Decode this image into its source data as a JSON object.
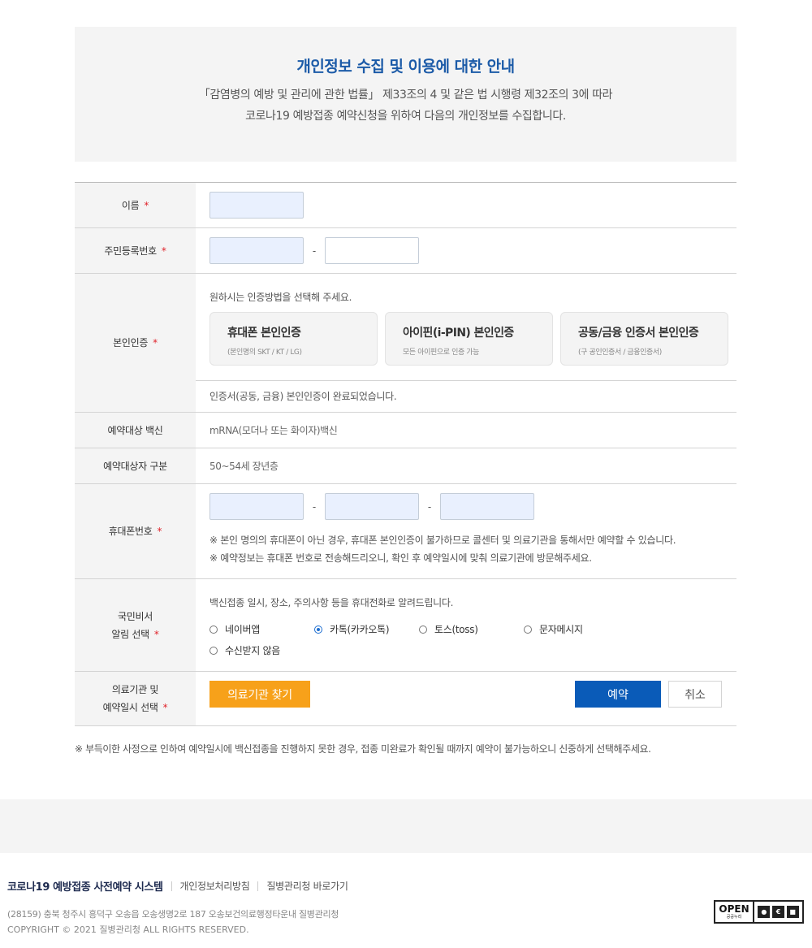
{
  "notice": {
    "title": "개인정보 수집 및 이용에 대한 안내",
    "line1": "「감염병의 예방 및 관리에 관한 법률」 제33조의 4 및 같은 법 시행령 제32조의 3에 따라",
    "line2": "코로나19 예방접종 예약신청을 위하여 다음의 개인정보를 수집합니다."
  },
  "form": {
    "required_mark": "*",
    "name_label": "이름",
    "jumin_label": "주민등록번호",
    "jumin_dash": "-",
    "auth_label": "본인인증",
    "auth_guide": "원하시는 인증방법을 선택해 주세요.",
    "auth_methods": [
      {
        "title": "휴대폰 본인인증",
        "sub": "(본인명의 SKT / KT / LG)"
      },
      {
        "title": "아이핀(i-PIN) 본인인증",
        "sub": "모든 아이핀으로 인증 가능"
      },
      {
        "title": "공동/금융 인증서 본인인증",
        "sub": "(구 공인인증서 / 금융인증서)"
      }
    ],
    "auth_done": "인증서(공동, 금융) 본인인증이 완료되었습니다.",
    "vaccine_label": "예약대상 백신",
    "vaccine_value": "mRNA(모더나 또는 화이자)백신",
    "group_label": "예약대상자 구분",
    "group_value": "50~54세 장년층",
    "phone_label": "휴대폰번호",
    "phone_dash": "-",
    "phone_note1": "※ 본인 명의의 휴대폰이 아닌 경우, 휴대폰 본인인증이 불가하므로 콜센터 및 의료기관을 통해서만 예약할 수 있습니다.",
    "phone_note2": "※ 예약정보는 휴대폰 번호로 전송해드리오니, 확인 후 예약일시에 맞춰 의료기관에 방문해주세요.",
    "alarm_label_1": "국민비서",
    "alarm_label_2": "알림 선택",
    "alarm_guide": "백신접종 일시, 장소, 주의사항 등을 휴대전화로 알려드립니다.",
    "alarm_options": [
      {
        "label": "네이버앱",
        "selected": false
      },
      {
        "label": "카톡(카카오톡)",
        "selected": true
      },
      {
        "label": "토스(toss)",
        "selected": false
      },
      {
        "label": "문자메시지",
        "selected": false
      },
      {
        "label": "수신받지 않음",
        "selected": false
      }
    ],
    "hosp_label_1": "의료기관 및",
    "hosp_label_2": "예약일시 선택",
    "find_button": "의료기관 찾기",
    "reserve_button": "예약",
    "cancel_button": "취소"
  },
  "bottom_note": "※ 부득이한 사정으로 인하여 예약일시에 백신접종을 진행하지 못한 경우, 접종 미완료가 확인될 때까지 예약이 불가능하오니 신중하게 선택해주세요.",
  "footer": {
    "brand": "코로나19 예방접종 사전예약 시스템",
    "links": [
      "개인정보처리방침",
      "질병관리청 바로가기"
    ],
    "address": "(28159) 충북 청주시 흥덕구 오송읍 오송생명2로 187 오송보건의료행정타운내 질병관리청",
    "copyright": "COPYRIGHT © 2021 질병관리청 ALL RIGHTS RESERVED.",
    "kogl_open": "OPEN",
    "kogl_sub": "공공누리"
  },
  "colors": {
    "title_blue": "#1c5ba8",
    "required_red": "#e0232b",
    "find_orange": "#f7a11a",
    "reserve_blue": "#0a5bb8"
  }
}
